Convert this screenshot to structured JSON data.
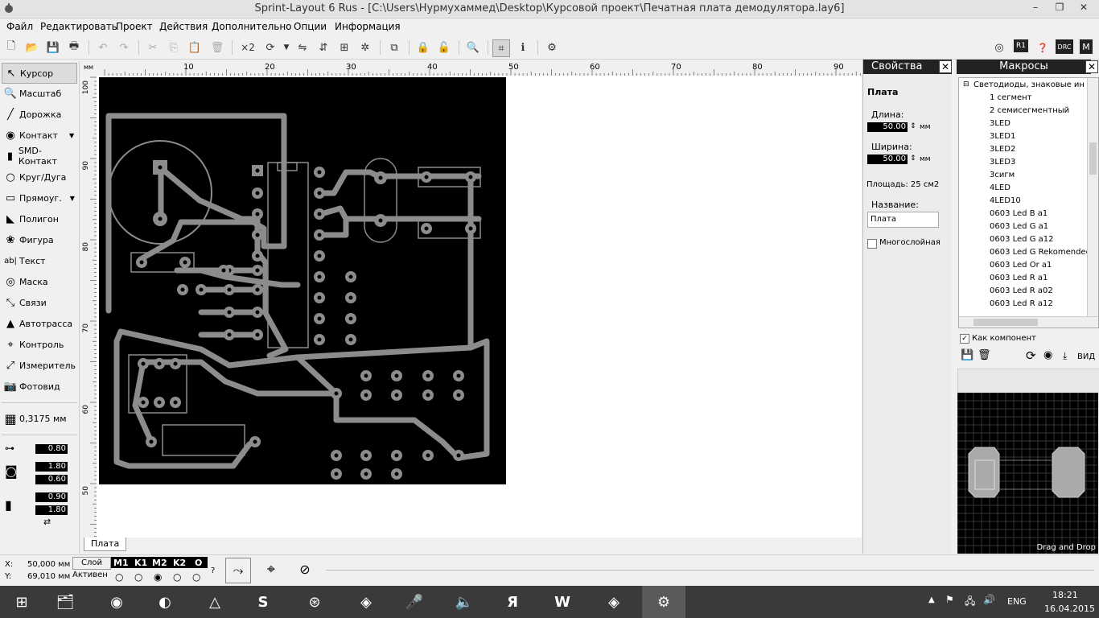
{
  "window": {
    "title": "Sprint-Layout 6 Rus - [C:\\Users\\Нурмухаммед\\Desktop\\Курсовой проект\\Печатная плата демодулятора.lay6]",
    "minimize": "–",
    "restore": "❐",
    "close": "✕"
  },
  "menu": [
    "Файл",
    "Редактировать",
    "Проект",
    "Действия",
    "Дополнительно",
    "Опции",
    "Информация"
  ],
  "toolbar": {
    "x2_label": "×2",
    "drc_label": "DRC",
    "r1_label": "R1"
  },
  "tools": [
    {
      "icon": "cursor-icon",
      "label": "Курсор"
    },
    {
      "icon": "zoom-icon",
      "label": "Масштаб"
    },
    {
      "icon": "track-icon",
      "label": "Дорожка"
    },
    {
      "icon": "pad-icon",
      "label": "Контакт"
    },
    {
      "icon": "smd-icon",
      "label": "SMD-Контакт"
    },
    {
      "icon": "circle-icon",
      "label": "Круг/Дуга"
    },
    {
      "icon": "rect-icon",
      "label": "Прямоуг."
    },
    {
      "icon": "polygon-icon",
      "label": "Полигон"
    },
    {
      "icon": "figure-icon",
      "label": "Фигура"
    },
    {
      "icon": "text-icon",
      "label": "Текст"
    },
    {
      "icon": "mask-icon",
      "label": "Маска"
    },
    {
      "icon": "links-icon",
      "label": "Связи"
    },
    {
      "icon": "autoroute-icon",
      "label": "Автотрасса"
    },
    {
      "icon": "control-icon",
      "label": "Контроль"
    },
    {
      "icon": "measure-icon",
      "label": "Измеритель"
    },
    {
      "icon": "photo-icon",
      "label": "Фотовид"
    }
  ],
  "grid": "0,3175 мм",
  "widths": {
    "track": "0.80",
    "pad_outer": "1.80",
    "pad_inner": "0.60",
    "smd_w": "0.90",
    "smd_h": "1.80"
  },
  "ruler": {
    "unit": "мм",
    "top_ticks": [
      "10",
      "20",
      "30",
      "40",
      "50",
      "60",
      "70",
      "80",
      "90"
    ],
    "left_ticks": [
      "100",
      "90",
      "80",
      "70",
      "60",
      "50"
    ]
  },
  "sheet_tab": "Плата",
  "properties": {
    "header": "Свойства",
    "section": "Плата",
    "length_label": "Длина:",
    "length_value": "50.00",
    "width_label": "Ширина:",
    "width_value": "50.00",
    "unit": "мм",
    "area": "Площадь: 25 см2",
    "name_label": "Название:",
    "name_value": "Плата",
    "multilayer": "Многослойная"
  },
  "macros": {
    "header": "Макросы",
    "folder": "Светодиоды, знаковые ин",
    "items": [
      "1 сегмент",
      "2 семисегментный",
      "3LED",
      "3LED1",
      "3LED2",
      "3LED3",
      "3сигм",
      "4LED",
      "4LED10",
      "0603 Led B a1",
      "0603 Led G a1",
      "0603 Led G a12",
      "0603 Led G Rekomendec",
      "0603 Led Or a1",
      "0603 Led R a1",
      "0603 Led R a02",
      "0603 Led R a12"
    ],
    "as_component": "Как компонент",
    "view_label": "ВИД",
    "drag_drop": "Drag and Drop"
  },
  "status": {
    "x_label": "X:",
    "x_value": "50,000 мм",
    "y_label": "Y:",
    "y_value": "69,010 мм",
    "layer_label": "Слой",
    "active_label": "Активен",
    "layers": [
      "M1",
      "K1",
      "M2",
      "K2",
      "O"
    ],
    "help": "?"
  },
  "taskbar": {
    "lang": "ENG",
    "time": "18:21",
    "date": "16.04.2015"
  },
  "colors": {
    "board": "#000000",
    "trace": "#8c8c8c",
    "panel_head": "#222222"
  }
}
